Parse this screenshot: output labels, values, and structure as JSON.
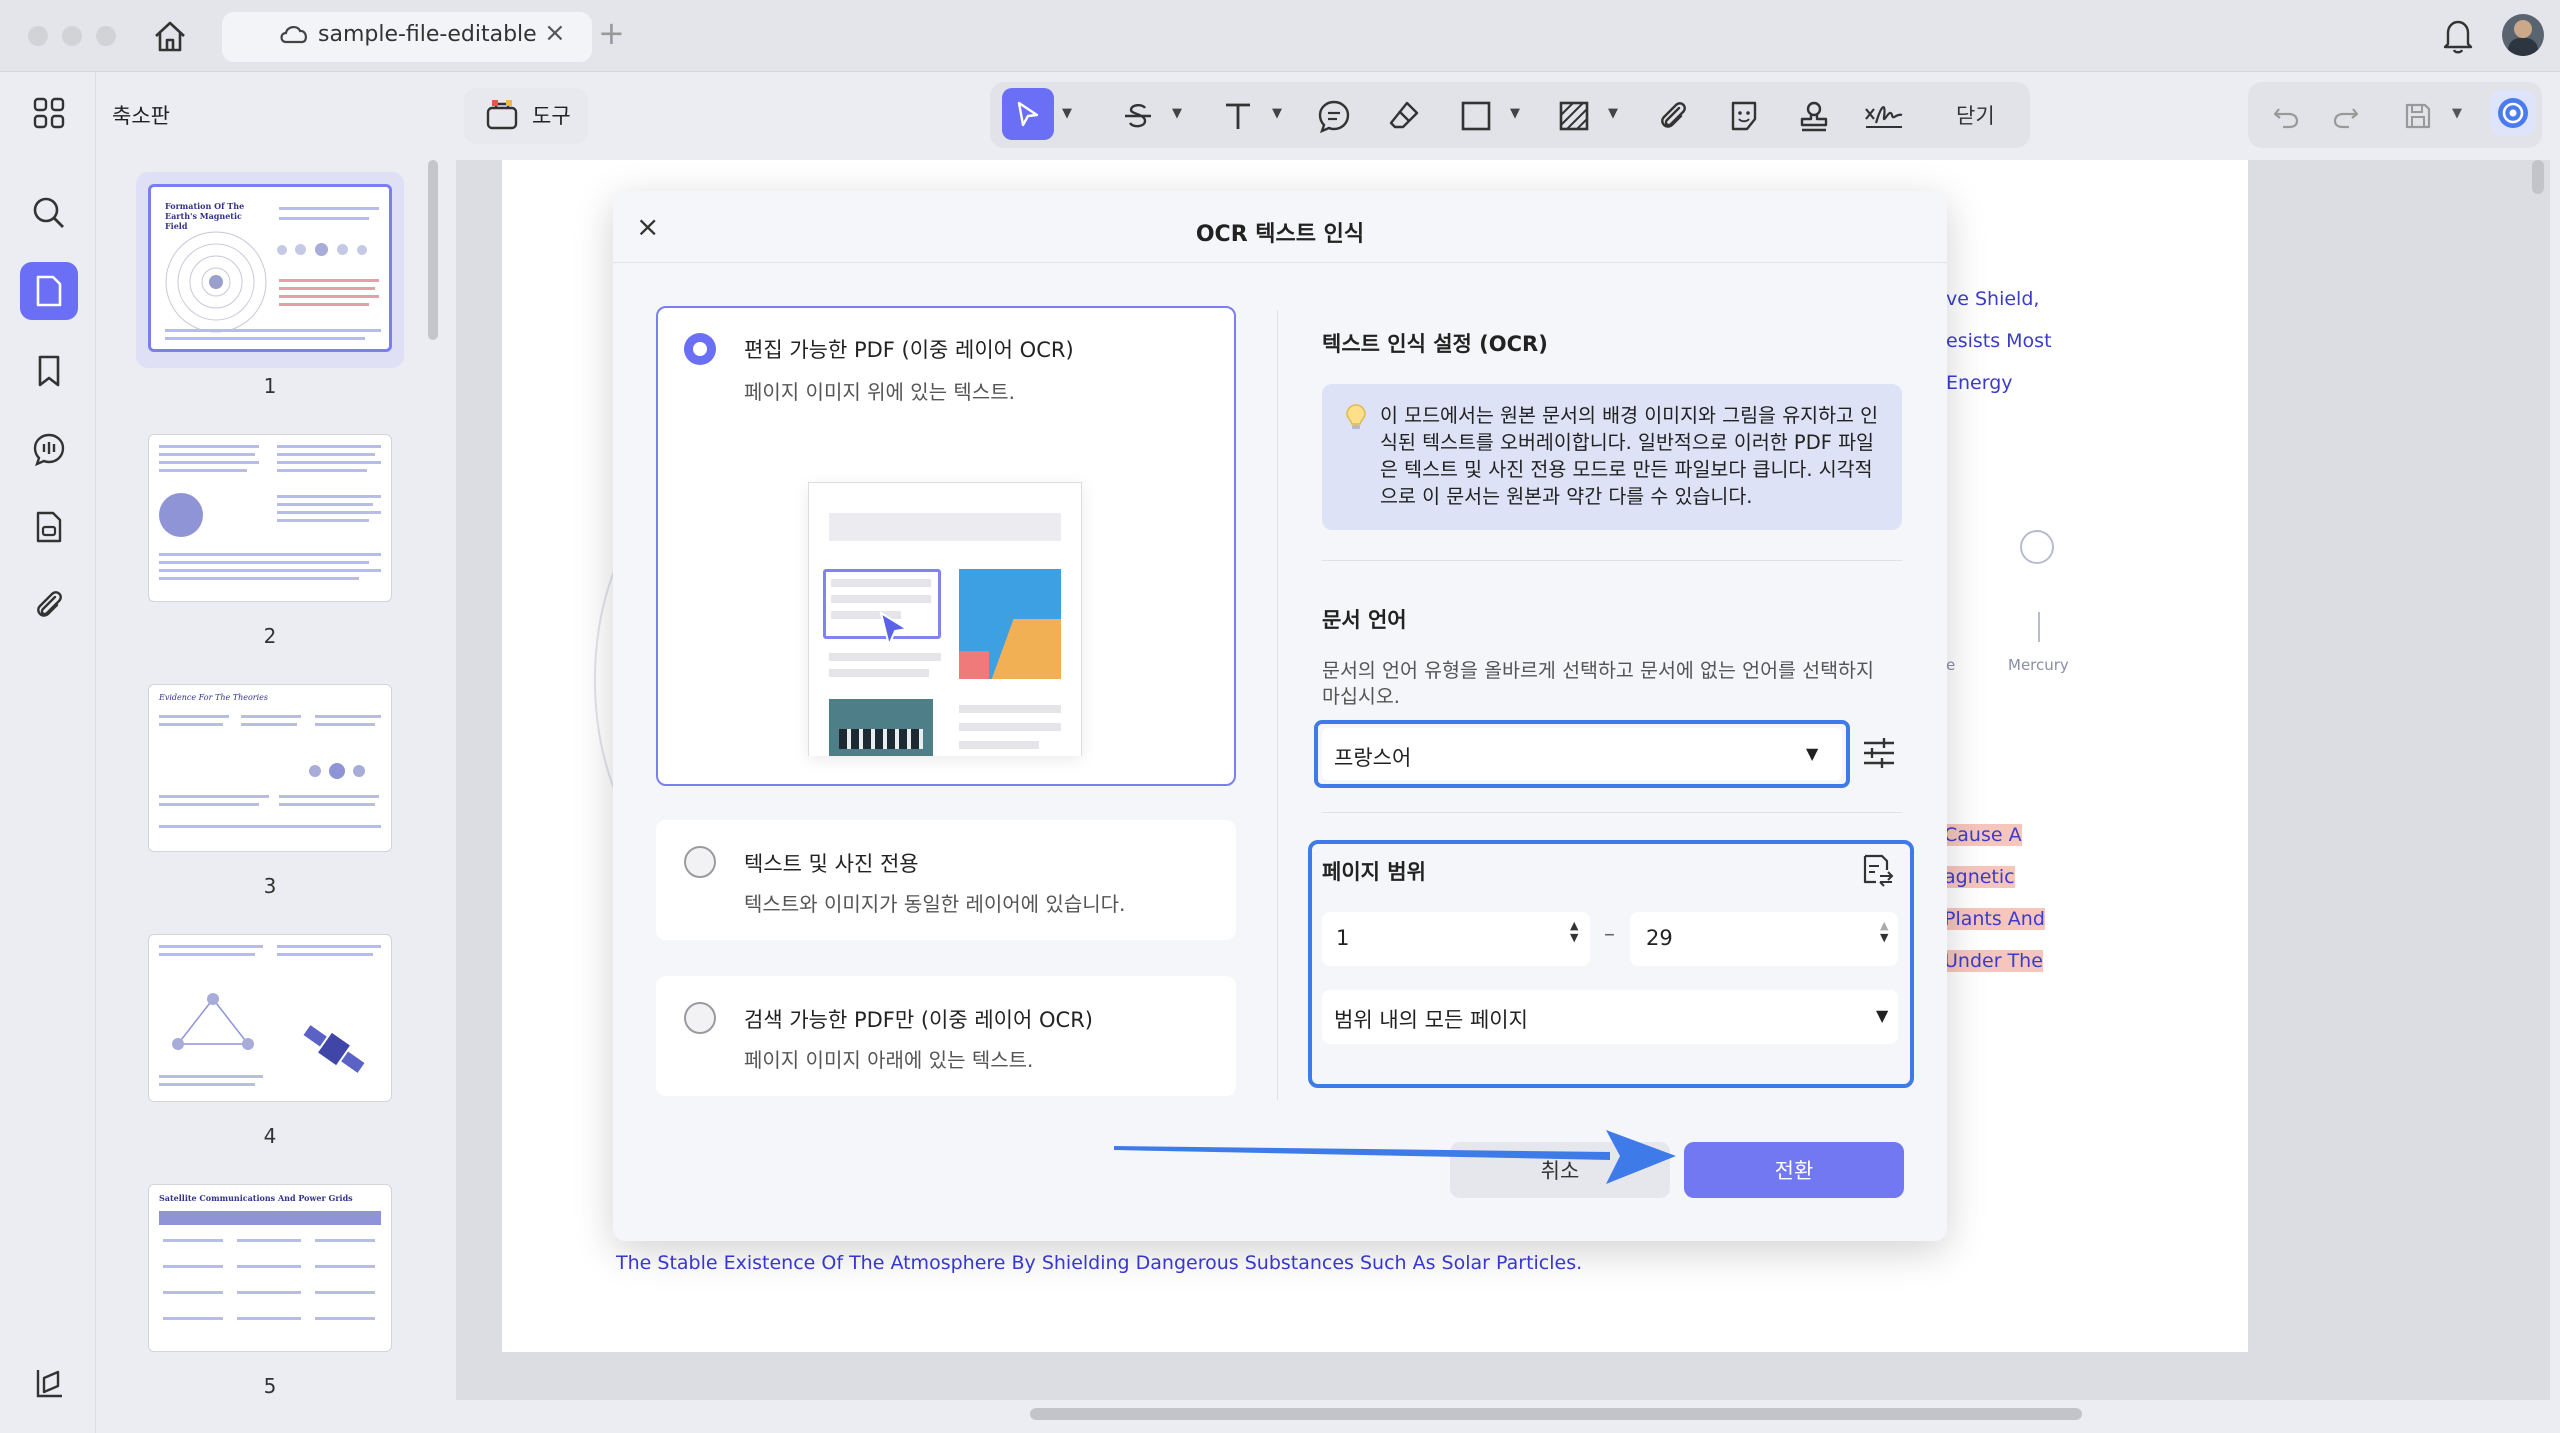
{
  "window": {
    "tab_title": "sample-file-editable",
    "tab_close": "×",
    "tab_add": "+"
  },
  "sidebar": {
    "panel_title": "축소판",
    "thumbnails": [
      {
        "page": "1",
        "heading": "Formation Of The Earth's Magnetic Field"
      },
      {
        "page": "2",
        "heading": ""
      },
      {
        "page": "3",
        "heading": "Evidence For The Theories"
      },
      {
        "page": "4",
        "heading": ""
      },
      {
        "page": "5",
        "heading": "Satellite Communications And Power Grids"
      }
    ]
  },
  "toolbar": {
    "tools_label": "도구",
    "close_label": "닫기"
  },
  "document": {
    "bg_lines": [
      "ve Shield,",
      "esists Most",
      "Energy"
    ],
    "bg_mercury": "Mercury",
    "bg_e": "e",
    "bg_highlights": [
      "Cause A",
      "agnetic",
      "Plants And",
      "Under The"
    ],
    "footer_line": "The Stable Existence Of The Atmosphere By Shielding Dangerous Substances Such As Solar Particles."
  },
  "dialog": {
    "title": "OCR 텍스트 인식",
    "close": "×",
    "options": [
      {
        "title": "편집 가능한 PDF (이중 레이어 OCR)",
        "desc": "페이지 이미지 위에 있는 텍스트.",
        "selected": true
      },
      {
        "title": "텍스트 및 사진 전용",
        "desc": "텍스트와 이미지가 동일한 레이어에 있습니다.",
        "selected": false
      },
      {
        "title": "검색 가능한 PDF만 (이중 레이어 OCR)",
        "desc": "페이지 이미지 아래에 있는 텍스트.",
        "selected": false
      }
    ],
    "settings_title": "텍스트 인식 설정 (OCR)",
    "info_text": "이 모드에서는 원본 문서의 배경 이미지와 그림을 유지하고 인식된 텍스트를 오버레이합니다. 일반적으로 이러한 PDF 파일은 텍스트 및 사진 전용 모드로 만든 파일보다 큽니다. 시각적으로 이 문서는 원본과 약간 다를 수 있습니다.",
    "language_title": "문서 언어",
    "language_desc": "문서의 언어 유형을 올바르게 선택하고 문서에 없는 언어를 선택하지 마십시오.",
    "language_value": "프랑스어",
    "range_title": "페이지 범위",
    "range_from": "1",
    "range_to": "29",
    "range_dash": "–",
    "range_mode": "범위 내의 모든 페이지",
    "cancel_label": "취소",
    "convert_label": "전환"
  },
  "colors": {
    "accent": "#7277f2",
    "highlight_border": "#3f7be8",
    "doc_text": "#3c3ccc"
  }
}
